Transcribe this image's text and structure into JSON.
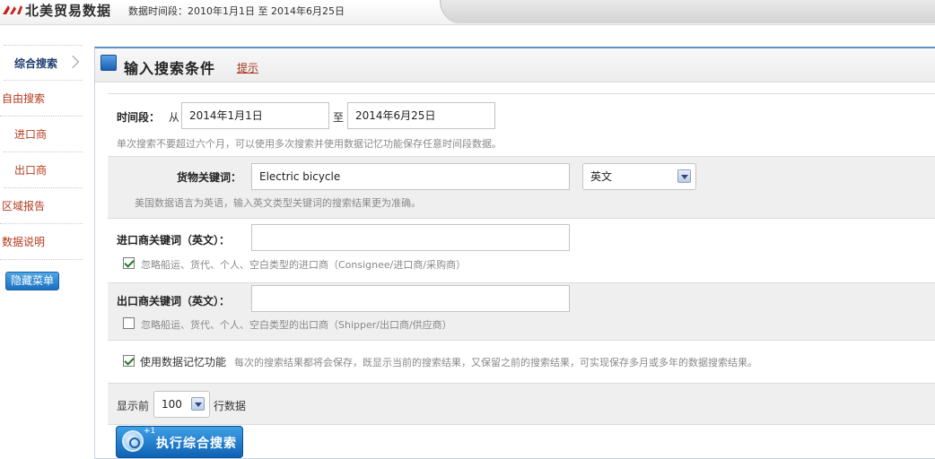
{
  "header": {
    "app_title": "北美贸易数据",
    "date_range": "数据时间段：2010年1月1日 至 2014年6月25日"
  },
  "sidebar": {
    "items": [
      {
        "label": "综合搜索"
      },
      {
        "label": "自由搜索"
      },
      {
        "label": "进口商"
      },
      {
        "label": "出口商"
      },
      {
        "label": "区域报告"
      },
      {
        "label": "数据说明"
      }
    ],
    "hide_menu_label": "隐藏菜单"
  },
  "panel": {
    "title": "输入搜索条件",
    "hint_link": "提示"
  },
  "form": {
    "time_label": "时间段：",
    "from_label": "从",
    "start_date": "2014年1月1日",
    "to_label": "至",
    "end_date": "2014年6月25日",
    "time_note": "单次搜索不要超过六个月，可以使用多次搜索并使用数据记忆功能保存任意时间段数据。",
    "keyword_label": "货物关键词：",
    "keyword_value": "Electric bicycle",
    "language_selected": "英文",
    "language_note": "美国数据语言为英语，输入英文类型关键词的搜索结果更为准确。",
    "importer_label": "进口商关键词（英文）：",
    "importer_value": "",
    "importer_checkbox_label": "忽略船运、货代、个人、空白类型的进口商（Consignee/进口商/采购商）",
    "importer_checkbox_checked": true,
    "exporter_label": "出口商关键词（英文）：",
    "exporter_value": "",
    "exporter_checkbox_label": "忽略船运、货代、个人、空白类型的出口商（Shipper/出口商/供应商）",
    "exporter_checkbox_checked": false,
    "memory_checkbox_label": "使用数据记忆功能",
    "memory_checkbox_checked": true,
    "memory_note": "每次的搜索结果都将会保存，既显示当前的搜索结果，又保留之前的搜索结果，可实现保存多月或多年的数据搜索结果。",
    "show_prefix": "显示前",
    "show_count": "100",
    "show_suffix": "行数据",
    "search_button": "执行综合搜索",
    "search_button_badge": "+1"
  },
  "colors": {
    "accent_blue": "#1a6fc0",
    "link_red": "#b43a1e",
    "check_green": "#1f7a1f"
  }
}
